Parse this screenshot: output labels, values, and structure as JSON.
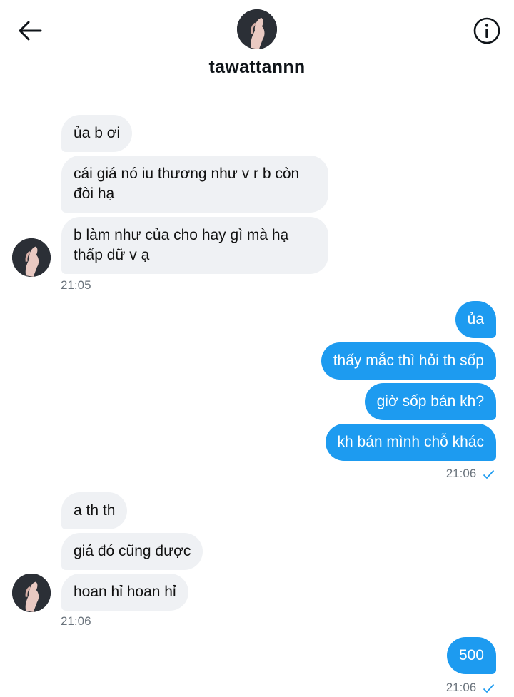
{
  "header": {
    "username": "tawattannn"
  },
  "messages": {
    "in1": [
      "ủa b ơi",
      "cái giá nó iu thương như v r b còn\nđòi hạ",
      "b làm như của cho hay gì mà hạ\nthấp dữ v ạ"
    ],
    "in1_time": "21:05",
    "out1": [
      "ủa",
      "thấy mắc thì hỏi th sốp",
      "giờ sốp bán kh?",
      "kh bán mình chỗ khác"
    ],
    "out1_time": "21:06",
    "in2": [
      "a th th",
      "giá đó cũng được",
      "hoan hỉ hoan hỉ"
    ],
    "in2_time": "21:06",
    "out2": [
      "500"
    ],
    "out2_time": "21:06"
  },
  "colors": {
    "accent": "#1d9bf0",
    "incoming_bubble": "#eff1f4"
  },
  "icons": {
    "back": "arrow-left-icon",
    "info": "info-icon",
    "read": "checkmark-icon"
  }
}
